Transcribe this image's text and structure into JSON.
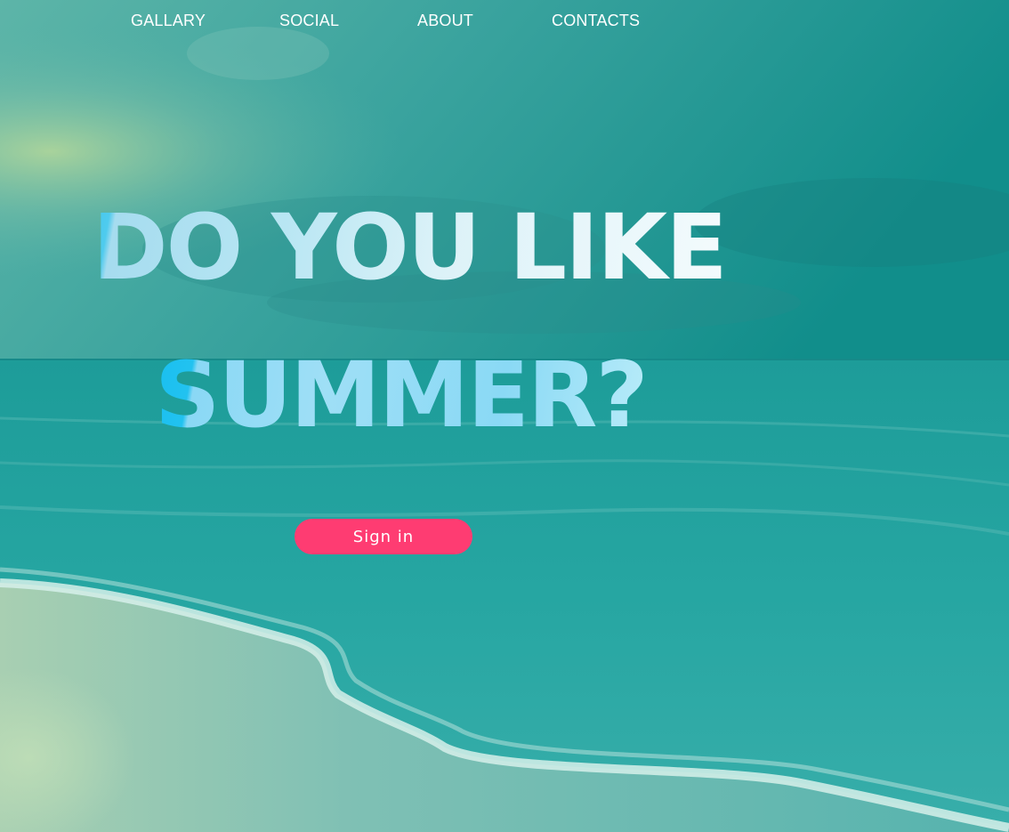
{
  "nav": {
    "items": [
      {
        "label": "GALLARY"
      },
      {
        "label": "SOCIAL"
      },
      {
        "label": "ABOUT"
      },
      {
        "label": "CONTACTS"
      }
    ]
  },
  "hero": {
    "headline_line1": "DO YOU LIKE",
    "headline_line2": "SUMMER?",
    "signin_label": "Sign in"
  },
  "colors": {
    "overlay": "#1f9a98",
    "button": "#fe3c72",
    "nav_text": "#ffffff"
  }
}
